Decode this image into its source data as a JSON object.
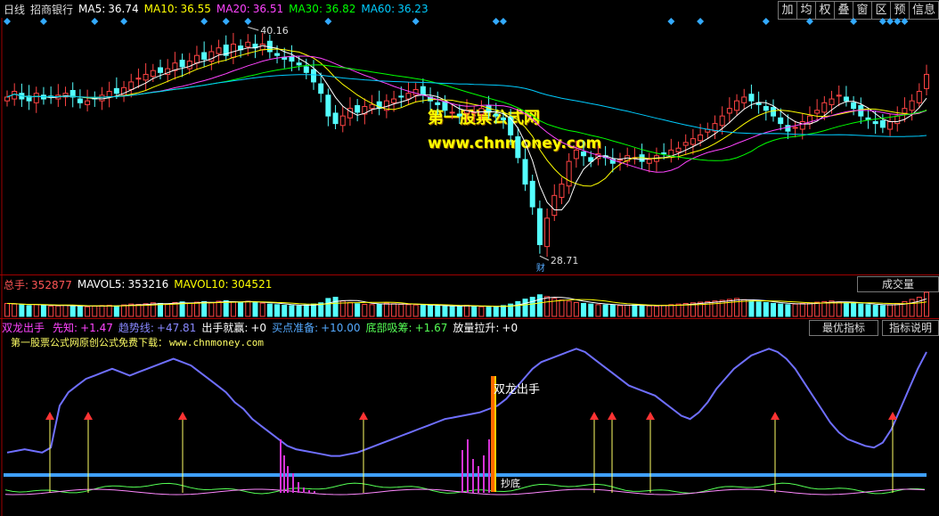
{
  "header": {
    "period": "日线",
    "stock_name": "招商银行",
    "ma": [
      {
        "label": "MA5:",
        "value": "36.74",
        "color": "#ffffff"
      },
      {
        "label": "MA10:",
        "value": "36.55",
        "color": "#ffff00"
      },
      {
        "label": "MA20:",
        "value": "36.51",
        "color": "#ff44ff"
      },
      {
        "label": "MA30:",
        "value": "36.82",
        "color": "#00ff00"
      },
      {
        "label": "MA60:",
        "value": "36.23",
        "color": "#00ccff"
      }
    ],
    "toolbar": [
      "加",
      "均",
      "权",
      "叠",
      "窗",
      "区",
      "预",
      "信息"
    ]
  },
  "price_panel": {
    "high_label": "40.16",
    "low_label": "28.71",
    "caiwu_marker": "财",
    "watermark_title": "第一股票公式网",
    "watermark_url": "www.chnmoney.com"
  },
  "volume_panel": {
    "items": [
      {
        "label": "总手:",
        "value": "352877",
        "color": "#ff5555"
      },
      {
        "label": "MAVOL5:",
        "value": "353216",
        "color": "#ffffff"
      },
      {
        "label": "MAVOL10:",
        "value": "304521",
        "color": "#ffff00"
      }
    ],
    "dropdown": "成交量"
  },
  "indicator_panel": {
    "items": [
      {
        "label": "双龙出手",
        "value": "",
        "color": "#ff44ff"
      },
      {
        "label": "先知:",
        "value": "+1.47",
        "color": "#ff44ff"
      },
      {
        "label": "趋势线:",
        "value": "+47.81",
        "color": "#8888ff"
      },
      {
        "label": "出手就赢:",
        "value": "+0",
        "color": "#ffffff"
      },
      {
        "label": "买点准备:",
        "value": "+10.00",
        "color": "#55aaff"
      },
      {
        "label": "底部吸筹:",
        "value": "+1.67",
        "color": "#55ff55"
      },
      {
        "label": "放量拉升:",
        "value": "+0",
        "color": "#ffffff"
      }
    ],
    "buttons": [
      "最优指标",
      "指标说明"
    ],
    "subtitle": "第一股票公式网原创公式免费下载：",
    "subtitle_url": "www.chnmoney.com",
    "annotation_main": "双龙出手",
    "annotation_bottom": "抄底"
  },
  "chart_data": {
    "type": "candlestick",
    "title": "招商银行 日线",
    "price_ylim": [
      28,
      41
    ],
    "series": [
      {
        "name": "MA5",
        "value": 36.74
      },
      {
        "name": "MA10",
        "value": 36.55
      },
      {
        "name": "MA20",
        "value": 36.51
      },
      {
        "name": "MA30",
        "value": 36.82
      },
      {
        "name": "MA60",
        "value": 36.23
      }
    ],
    "close": [
      37.0,
      37.3,
      36.9,
      36.8,
      37.2,
      36.9,
      37.0,
      37.1,
      37.2,
      37.0,
      36.7,
      36.8,
      36.9,
      37.1,
      37.3,
      37.2,
      37.5,
      37.8,
      38.0,
      38.2,
      38.4,
      38.3,
      38.5,
      38.8,
      38.6,
      38.9,
      39.2,
      39.0,
      39.4,
      39.6,
      39.2,
      39.8,
      39.5,
      39.9,
      39.6,
      39.8,
      39.4,
      39.2,
      39.0,
      38.9,
      38.7,
      38.3,
      37.8,
      37.2,
      36.0,
      35.6,
      36.0,
      36.4,
      36.2,
      36.5,
      36.6,
      36.4,
      36.8,
      36.9,
      37.0,
      37.2,
      37.4,
      37.1,
      36.8,
      36.6,
      36.3,
      36.2,
      36.0,
      36.3,
      36.2,
      36.4,
      36.2,
      36.0,
      35.8,
      35.0,
      33.8,
      32.4,
      31.2,
      29.2,
      30.6,
      31.8,
      32.4,
      33.6,
      34.2,
      33.9,
      33.6,
      34.0,
      33.8,
      33.5,
      33.7,
      33.9,
      33.8,
      33.6,
      33.7,
      33.9,
      34.0,
      34.2,
      34.3,
      34.6,
      34.8,
      35.0,
      35.3,
      35.6,
      36.0,
      36.4,
      36.8,
      37.0,
      36.8,
      36.6,
      36.3,
      36.0,
      35.6,
      35.2,
      35.4,
      35.7,
      36.0,
      36.3,
      36.7,
      36.9,
      37.1,
      36.8,
      36.4,
      36.0,
      35.8,
      35.6,
      35.4,
      35.7,
      36.0,
      36.4,
      36.8,
      37.3,
      38.2
    ],
    "volume": [
      42,
      40,
      38,
      35,
      38,
      36,
      33,
      34,
      36,
      35,
      32,
      31,
      33,
      35,
      36,
      34,
      37,
      40,
      39,
      41,
      44,
      42,
      40,
      45,
      47,
      43,
      46,
      48,
      44,
      49,
      51,
      47,
      45,
      49,
      46,
      43,
      40,
      38,
      36,
      35,
      34,
      37,
      40,
      44,
      58,
      62,
      50,
      45,
      41,
      39,
      38,
      40,
      43,
      41,
      39,
      38,
      37,
      36,
      35,
      34,
      33,
      32,
      34,
      36,
      33,
      31,
      30,
      32,
      35,
      40,
      48,
      56,
      62,
      70,
      64,
      58,
      53,
      49,
      45,
      42,
      40,
      38,
      37,
      36,
      35,
      36,
      37,
      35,
      34,
      33,
      36,
      38,
      40,
      42,
      44,
      46,
      48,
      50,
      52,
      55,
      58,
      54,
      50,
      47,
      45,
      42,
      40,
      38,
      40,
      42,
      44,
      46,
      48,
      50,
      47,
      44,
      42,
      40,
      38,
      36,
      35,
      38,
      42,
      48,
      55,
      62,
      78
    ],
    "indicator_trend": [
      32,
      33,
      34,
      33,
      32,
      35,
      60,
      68,
      72,
      76,
      78,
      80,
      82,
      80,
      78,
      80,
      82,
      84,
      86,
      88,
      86,
      84,
      80,
      76,
      72,
      68,
      62,
      58,
      52,
      48,
      44,
      40,
      36,
      34,
      33,
      32,
      31,
      30,
      30,
      31,
      32,
      34,
      36,
      38,
      40,
      42,
      44,
      46,
      48,
      50,
      52,
      53,
      54,
      55,
      56,
      58,
      60,
      64,
      70,
      76,
      82,
      86,
      88,
      90,
      92,
      94,
      92,
      88,
      84,
      80,
      76,
      72,
      70,
      68,
      66,
      62,
      58,
      54,
      52,
      56,
      62,
      70,
      76,
      82,
      86,
      90,
      92,
      94,
      92,
      88,
      82,
      74,
      66,
      58,
      50,
      44,
      40,
      38,
      36,
      35,
      38,
      46,
      58,
      70,
      82,
      92
    ]
  }
}
